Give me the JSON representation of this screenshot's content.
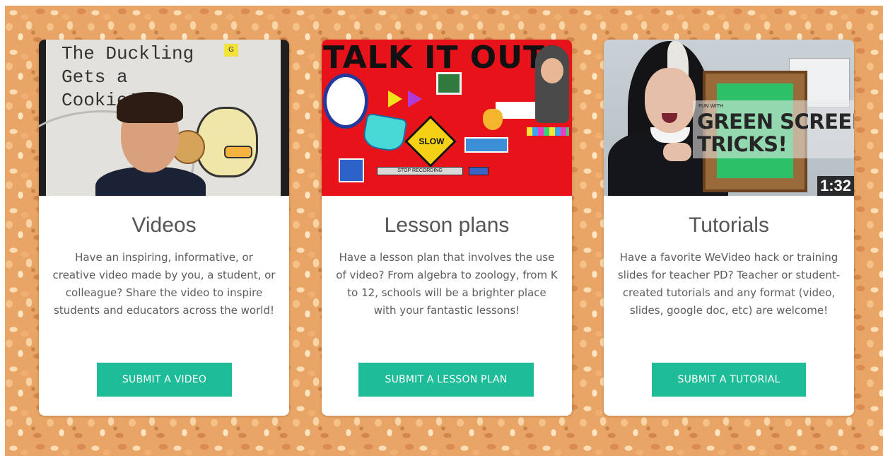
{
  "cards": [
    {
      "title": "Videos",
      "description": "Have an inspiring, informative, or creative video made by you, a student, or colleague? Share the video to inspire students and educators across the world!",
      "button_label": "SUBMIT A VIDEO",
      "thumbnail": {
        "book_text": "The Duckling\nGets a\nCookie!?",
        "tag_text": "G"
      }
    },
    {
      "title": "Lesson plans",
      "description": "Have a lesson plan that involves the use of video? From algebra to zoology, from K to 12, schools will be a brighter place with your fantastic lessons!",
      "button_label": "SUBMIT A LESSON PLAN",
      "thumbnail": {
        "headline": "TALK IT OUT!",
        "slow_sign": "SLOW",
        "stop_recording": "STOP RECORDING"
      }
    },
    {
      "title": "Tutorials",
      "description": "Have a favorite WeVideo hack or training slides for teacher PD? Teacher or student-created tutorials and any format (video, slides, google doc, etc) are welcome!",
      "button_label": "SUBMIT A TUTORIAL",
      "thumbnail": {
        "overlay_small": "FUN WITH",
        "overlay_title": "GREEN SCREEN\nTRICKS!",
        "duration": "1:32"
      }
    }
  ],
  "colors": {
    "button": "#1ebc98",
    "card_background": "#ffffff",
    "title_text": "#555555",
    "cork_background": "#e9a565"
  }
}
